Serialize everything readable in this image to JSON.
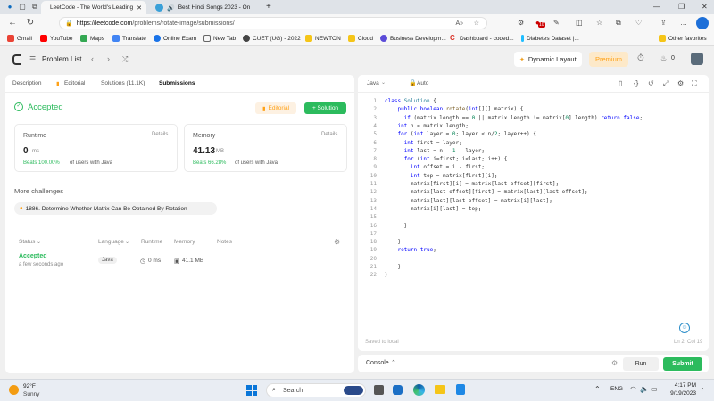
{
  "browser": {
    "tabs": [
      {
        "title": "LeetCode - The World's Leading",
        "active": true
      },
      {
        "title": "Best Hindi Songs 2023 - On",
        "active": false
      }
    ],
    "url_domain": "https://leetcode.com",
    "url_path": "/problems/rotate-image/submissions/",
    "bookmarks": [
      "Gmail",
      "YouTube",
      "Maps",
      "Translate",
      "Online Exam",
      "New Tab",
      "CUET (UG) - 2022",
      "NEWTON",
      "Cloud",
      "Business Developm...",
      "Dashboard - coded...",
      "Diabetes Dataset |...",
      "Other favorites"
    ],
    "notif_count": "10"
  },
  "header": {
    "problem_list": "Problem List",
    "dynamic_layout": "Dynamic Layout",
    "premium": "Premium",
    "streak": "0"
  },
  "left": {
    "tabs": [
      "Description",
      "Editorial",
      "Solutions (11.1K)",
      "Submissions"
    ],
    "status": "Accepted",
    "editorial_btn": "Editorial",
    "solution_btn": "+ Solution",
    "runtime": {
      "label": "Runtime",
      "details": "Details",
      "value": "0",
      "unit": "ms",
      "beats_pct": "Beats 100.00%",
      "beats_text": "of users with Java"
    },
    "memory": {
      "label": "Memory",
      "details": "Details",
      "value": "41.13",
      "unit": "MB",
      "beats_pct": "Beats 66.28%",
      "beats_text": "of users with Java"
    },
    "more_challenges": "More challenges",
    "challenge": "1886. Determine Whether Matrix Can Be Obtained By Rotation",
    "table_headers": [
      "Status",
      "Language",
      "Runtime",
      "Memory",
      "Notes"
    ],
    "row": {
      "status": "Accepted",
      "time": "a few seconds ago",
      "language": "Java",
      "runtime": "0 ms",
      "memory": "41.1 MB"
    }
  },
  "right": {
    "language": "Java",
    "mode": "Auto",
    "saved": "Saved to local",
    "cursor": "Ln 2, Col 19",
    "code_lines": [
      "class Solution {",
      "    public boolean rotate(int[][] matrix) {",
      "      if (matrix.length == 0 || matrix.length != matrix[0].length) return false;",
      "    int n = matrix.length;",
      "    for (int layer = 0; layer < n/2; layer++) {",
      "      int first = layer;",
      "      int last = n - 1 - layer;",
      "      for (int i=first; i<last; i++) {",
      "        int offset = i - first;",
      "        int top = matrix[first][i];",
      "        matrix[first][i] = matrix[last-offset][first];",
      "        matrix[last-offset][first] = matrix[last][last-offset];",
      "        matrix[last][last-offset] = matrix[i][last];",
      "        matrix[i][last] = top;",
      "",
      "      }",
      "",
      "    }",
      "    return true;",
      "",
      "    }",
      "}"
    ],
    "console": "Console",
    "run": "Run",
    "submit": "Submit"
  },
  "taskbar": {
    "temp": "92°F",
    "weather": "Sunny",
    "search": "Search",
    "lang": "ENG",
    "time": "4:17 PM",
    "date": "9/19/2023"
  }
}
